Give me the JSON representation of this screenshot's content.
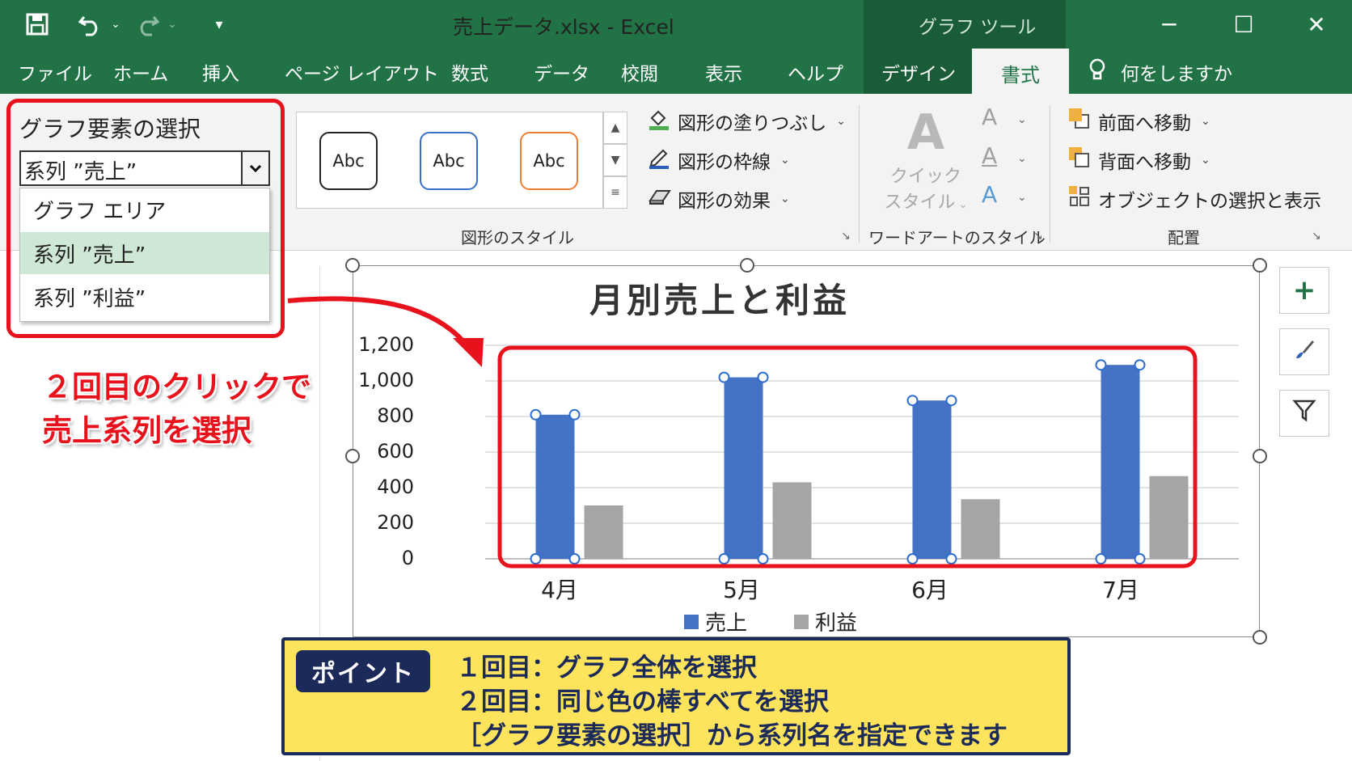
{
  "window": {
    "title": "売上データ.xlsx  -  Excel",
    "context_label": "グラフ ツール",
    "controls": {
      "minimize": "─",
      "maximize": "☐",
      "close": "✕"
    }
  },
  "qat": {
    "save_icon": "save-icon",
    "undo_icon": "undo-icon",
    "redo_icon": "redo-icon",
    "customize_icon": "customize-icon"
  },
  "tabs": [
    {
      "label": "ファイル"
    },
    {
      "label": "ホーム"
    },
    {
      "label": "挿入"
    },
    {
      "label": "ページ レイアウト"
    },
    {
      "label": "数式"
    },
    {
      "label": "データ"
    },
    {
      "label": "校閲"
    },
    {
      "label": "表示"
    },
    {
      "label": "ヘルプ"
    },
    {
      "label": "デザイン"
    },
    {
      "label": "書式"
    }
  ],
  "active_tab": "書式",
  "tell_me": "何をしますか",
  "element_selector": {
    "label": "グラフ要素の選択",
    "value": "系列 ”売上”",
    "options": [
      "グラフ エリア",
      "系列 ”売上”",
      "系列 ”利益”"
    ],
    "highlighted_index": 1
  },
  "shape_styles": {
    "gallery": [
      "Abc",
      "Abc",
      "Abc"
    ],
    "gallery_borders": [
      "#222222",
      "#3a6fc4",
      "#ed7d31"
    ],
    "fill": "図形の塗りつぶし",
    "outline": "図形の枠線",
    "effects": "図形の効果",
    "group_label": "図形のスタイル"
  },
  "wordart": {
    "quick_line1": "クイック",
    "quick_line2": "スタイル",
    "letter": "A",
    "group_label": "ワードアートのスタイル"
  },
  "arrange": {
    "bring_forward": "前面へ移動",
    "send_backward": "背面へ移動",
    "selection_pane": "オブジェクトの選択と表示",
    "group_label": "配置"
  },
  "callout": {
    "line1": "２回目のクリックで",
    "line2": "売上系列を選択"
  },
  "chart_data": {
    "type": "bar",
    "title": "月別売上と利益",
    "categories": [
      "4月",
      "5月",
      "6月",
      "7月"
    ],
    "series": [
      {
        "name": "売上",
        "values": [
          810,
          1020,
          890,
          1090
        ],
        "color": "#4472c4"
      },
      {
        "name": "利益",
        "values": [
          300,
          430,
          335,
          465
        ],
        "color": "#a5a5a5"
      }
    ],
    "yticks": [
      "1,200",
      "1,000",
      "800",
      "600",
      "400",
      "200",
      "0"
    ],
    "ylim": [
      0,
      1200
    ],
    "grid": true,
    "legend": "bottom",
    "selected_series": "売上"
  },
  "chart_side_buttons": {
    "elements": "+",
    "styles_icon": "brush-icon",
    "filter_icon": "filter-icon"
  },
  "point": {
    "badge": "ポイント",
    "line1": "１回目：グラフ全体を選択",
    "line2": "２回目：同じ色の棒すべてを選択",
    "line3": "［グラフ要素の選択］から系列名を指定できます"
  }
}
